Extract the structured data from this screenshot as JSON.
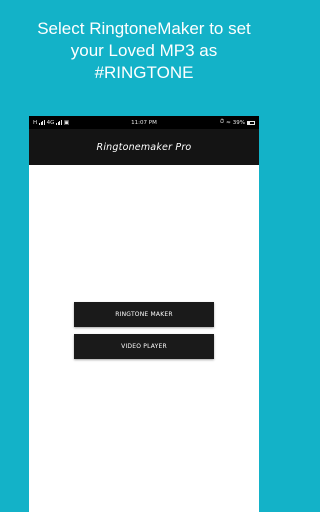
{
  "promo": {
    "line1": "Select RingtoneMaker to set",
    "line2": "your Loved MP3 as",
    "line3": "#RINGTONE"
  },
  "status_bar": {
    "left_text": "H",
    "network": "4G",
    "time": "11:07 PM",
    "battery": "39%"
  },
  "app_bar": {
    "title": "Ringtonemaker Pro"
  },
  "buttons": {
    "ringtone_maker": "RINGTONE MAKER",
    "video_player": "VIDEO PLAYER"
  },
  "colors": {
    "background": "#13b2c8",
    "app_bar": "#141414",
    "button": "#1a1a1a"
  }
}
